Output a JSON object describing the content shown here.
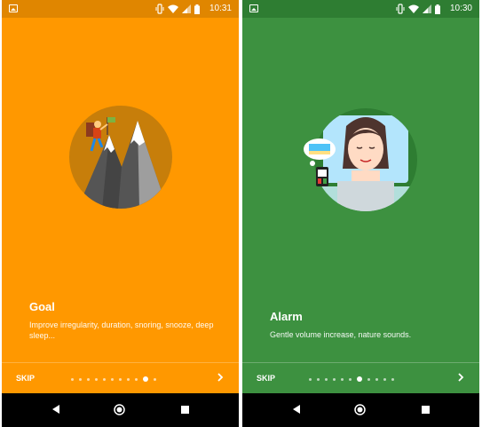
{
  "screens": [
    {
      "status_time": "10:31",
      "title": "Goal",
      "description": "Improve irregularity, duration, snoring, snooze, deep sleep...",
      "skip_label": "SKIP",
      "page_count": 11,
      "active_page": 10,
      "background_color": "#ff9800",
      "illustration": "mountain-climber-illustration"
    },
    {
      "status_time": "10:30",
      "title": "Alarm",
      "description": "Gentle volume increase, nature sounds.",
      "skip_label": "SKIP",
      "page_count": 11,
      "active_page": 7,
      "background_color": "#3d9140",
      "illustration": "sleeping-woman-illustration"
    }
  ],
  "icons": {
    "status": [
      "photo-icon",
      "vibrate-icon",
      "wifi-icon",
      "signal-icon",
      "battery-icon"
    ],
    "next": "chevron-right-icon",
    "nav": [
      "back-icon",
      "home-icon",
      "recents-icon"
    ]
  }
}
